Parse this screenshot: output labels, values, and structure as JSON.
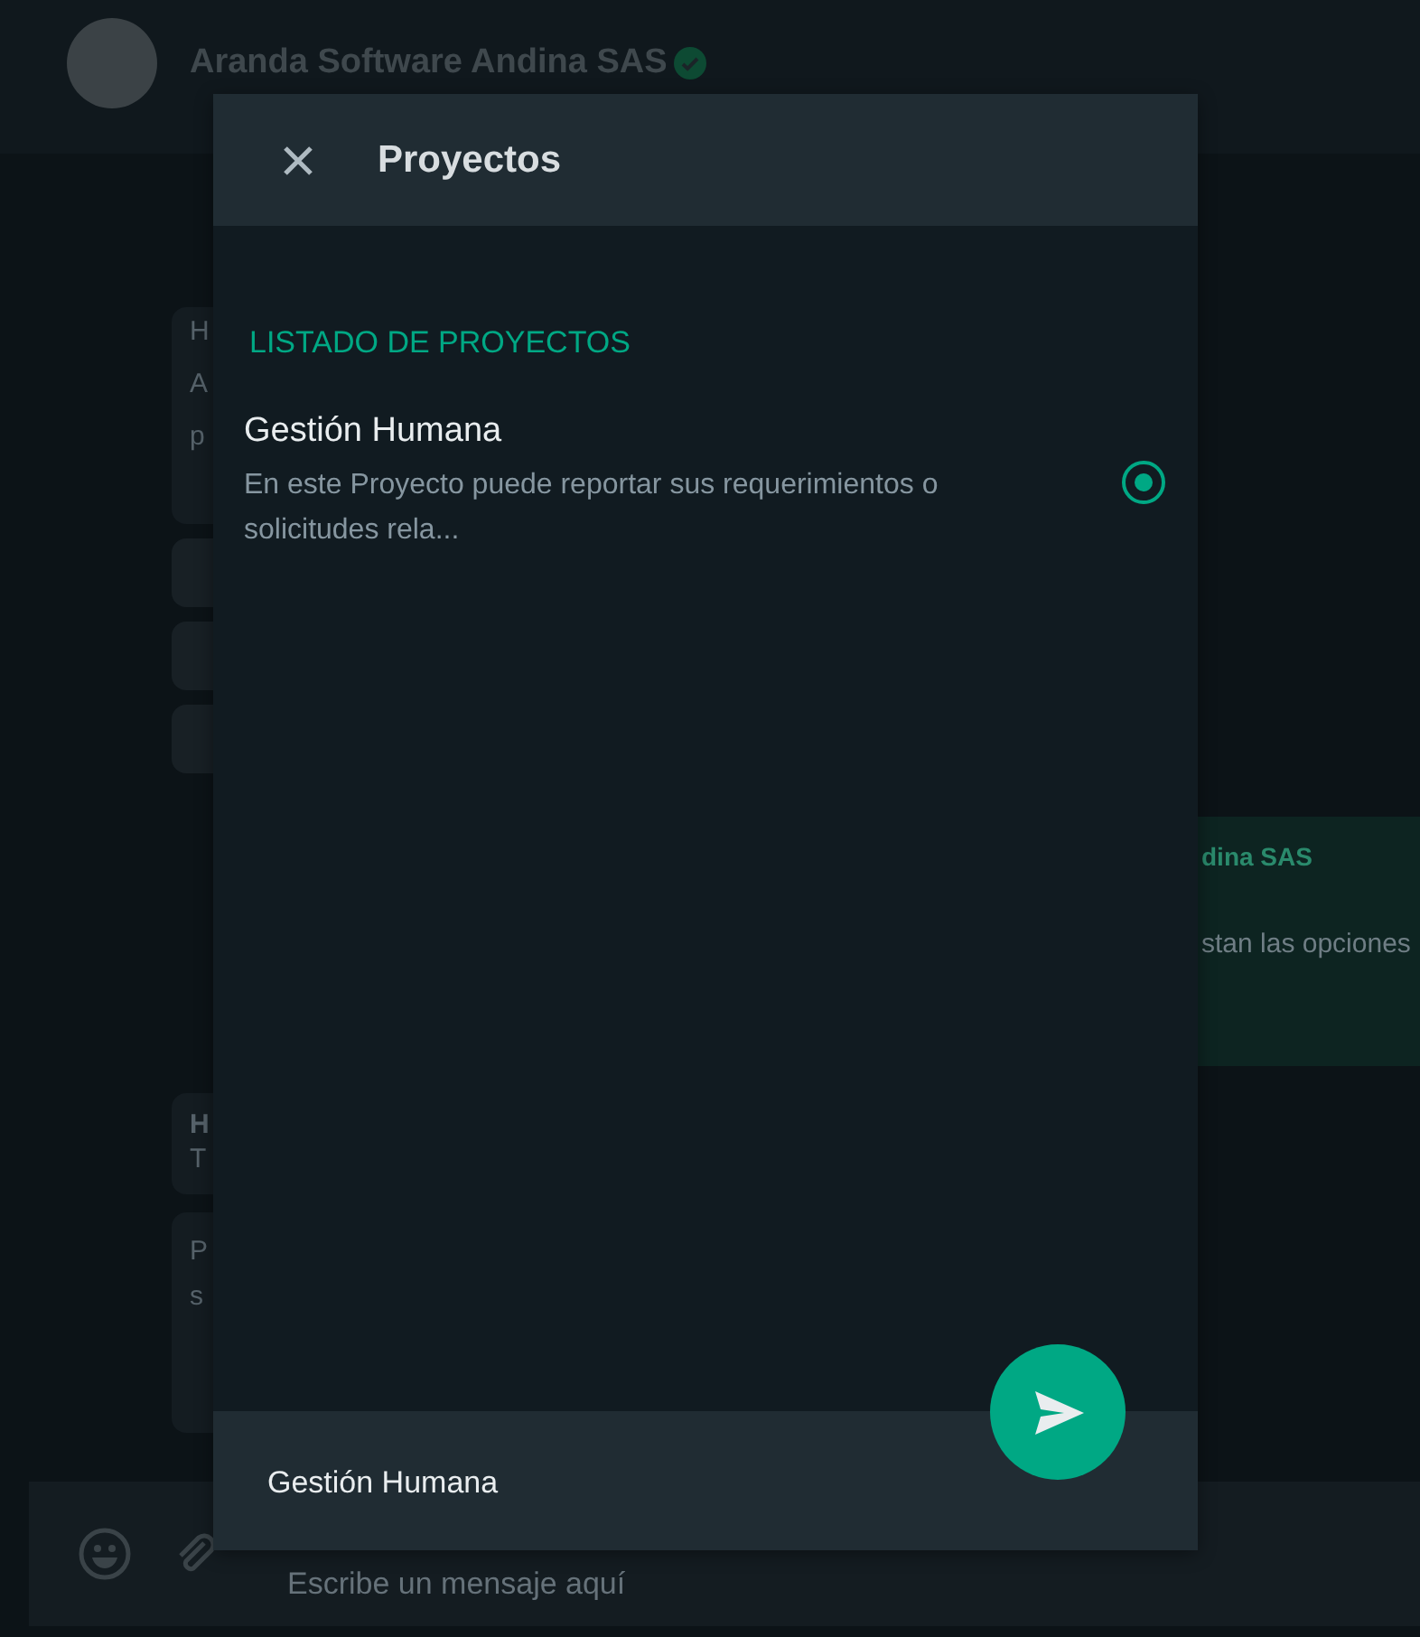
{
  "chat_header": {
    "title": "Aranda Software Andina SAS",
    "verified": true
  },
  "left_bubbles": [
    {
      "kind": "message",
      "lines": [
        {
          "text": "H",
          "bold": false
        },
        {
          "text": "A",
          "bold": false
        },
        {
          "text": "p",
          "bold": false
        }
      ]
    },
    {
      "kind": "reply-button"
    },
    {
      "kind": "reply-button"
    },
    {
      "kind": "reply-button"
    },
    {
      "kind": "message",
      "lines": [
        {
          "text": "H",
          "bold": true
        },
        {
          "text": "T",
          "bold": false
        }
      ]
    },
    {
      "kind": "message",
      "lines": [
        {
          "text": "P",
          "bold": false
        },
        {
          "text": "s",
          "bold": false
        }
      ]
    }
  ],
  "right_bubble": {
    "sender": "dina SAS",
    "text": "stan las opciones"
  },
  "composer": {
    "placeholder": "Escribe un mensaje aquí"
  },
  "dialog": {
    "title": "Proyectos",
    "section": "LISTADO DE PROYECTOS",
    "projects": [
      {
        "name": "Gestión Humana",
        "description": "En este Proyecto puede reportar sus requerimientos o solicitudes rela...",
        "selected": true
      }
    ],
    "selection": "Gestión Humana"
  }
}
